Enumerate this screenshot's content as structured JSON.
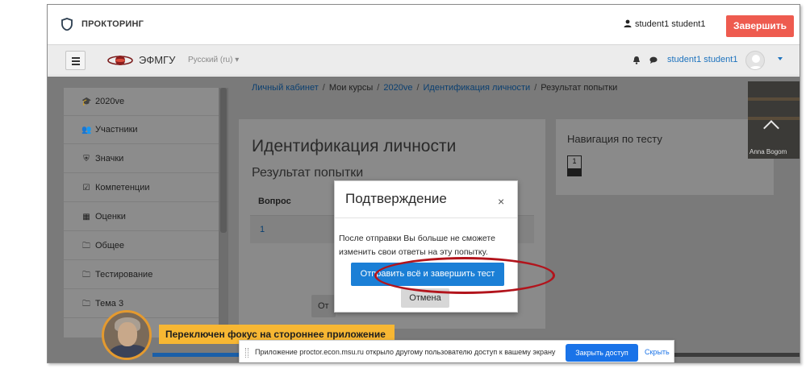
{
  "proctoring_bar": {
    "brand": "ПРОКТОРИНГ",
    "user": "student1 student1",
    "finish_label": "Завершить"
  },
  "navbar": {
    "site_name": "ЭФМГУ",
    "language": "Русский (ru) ▾",
    "user_name": "student1 student1"
  },
  "breadcrumb": {
    "items": [
      "Личный кабинет",
      "Мои курсы",
      "2020ve",
      "Идентификация личности",
      "Результат попытки"
    ],
    "separator": "/"
  },
  "sidebar": {
    "items": [
      {
        "icon": "graduation-cap-icon",
        "glyph": "🎓",
        "label": "2020ve"
      },
      {
        "icon": "users-icon",
        "glyph": "👥",
        "label": "Участники"
      },
      {
        "icon": "shield-icon",
        "glyph": "⛨",
        "label": "Значки"
      },
      {
        "icon": "checkbox-icon",
        "glyph": "☑",
        "label": "Компетенции"
      },
      {
        "icon": "table-icon",
        "glyph": "▦",
        "label": "Оценки"
      },
      {
        "icon": "folder-icon",
        "glyph": "🗀",
        "label": "Общее"
      },
      {
        "icon": "folder-icon",
        "glyph": "🗀",
        "label": "Тестирование"
      },
      {
        "icon": "folder-icon",
        "glyph": "🗀",
        "label": "Тема 3"
      }
    ]
  },
  "main": {
    "title": "Идентификация личности",
    "subtitle": "Результат попытки",
    "table_header": "Вопрос",
    "rows": [
      "1"
    ],
    "button_partial": "От"
  },
  "quiz_nav": {
    "title": "Навигация по тесту",
    "question_number": "1"
  },
  "webcam": {
    "name": "Anna Bogom"
  },
  "modal": {
    "title": "Подтверждение",
    "close_glyph": "×",
    "body": "После отправки Вы больше не сможете изменить свои ответы на эту попытку.",
    "submit_label": "Отправить всё и завершить тест",
    "cancel_label": "Отмена"
  },
  "alert": {
    "message": "Переключен фокус на стороннее приложение"
  },
  "screen_share": {
    "message": "Приложение proctor.econ.msu.ru открыло другому пользователю доступ к вашему экрану",
    "stop_label": "Закрыть доступ",
    "hide_label": "Скрыть"
  },
  "colors": {
    "finish_button": "#ee5b4f",
    "submit_button": "#1b7fd6",
    "highlight_ring": "#b2141c",
    "alert_background": "#f7b733",
    "link": "#1e73be"
  }
}
